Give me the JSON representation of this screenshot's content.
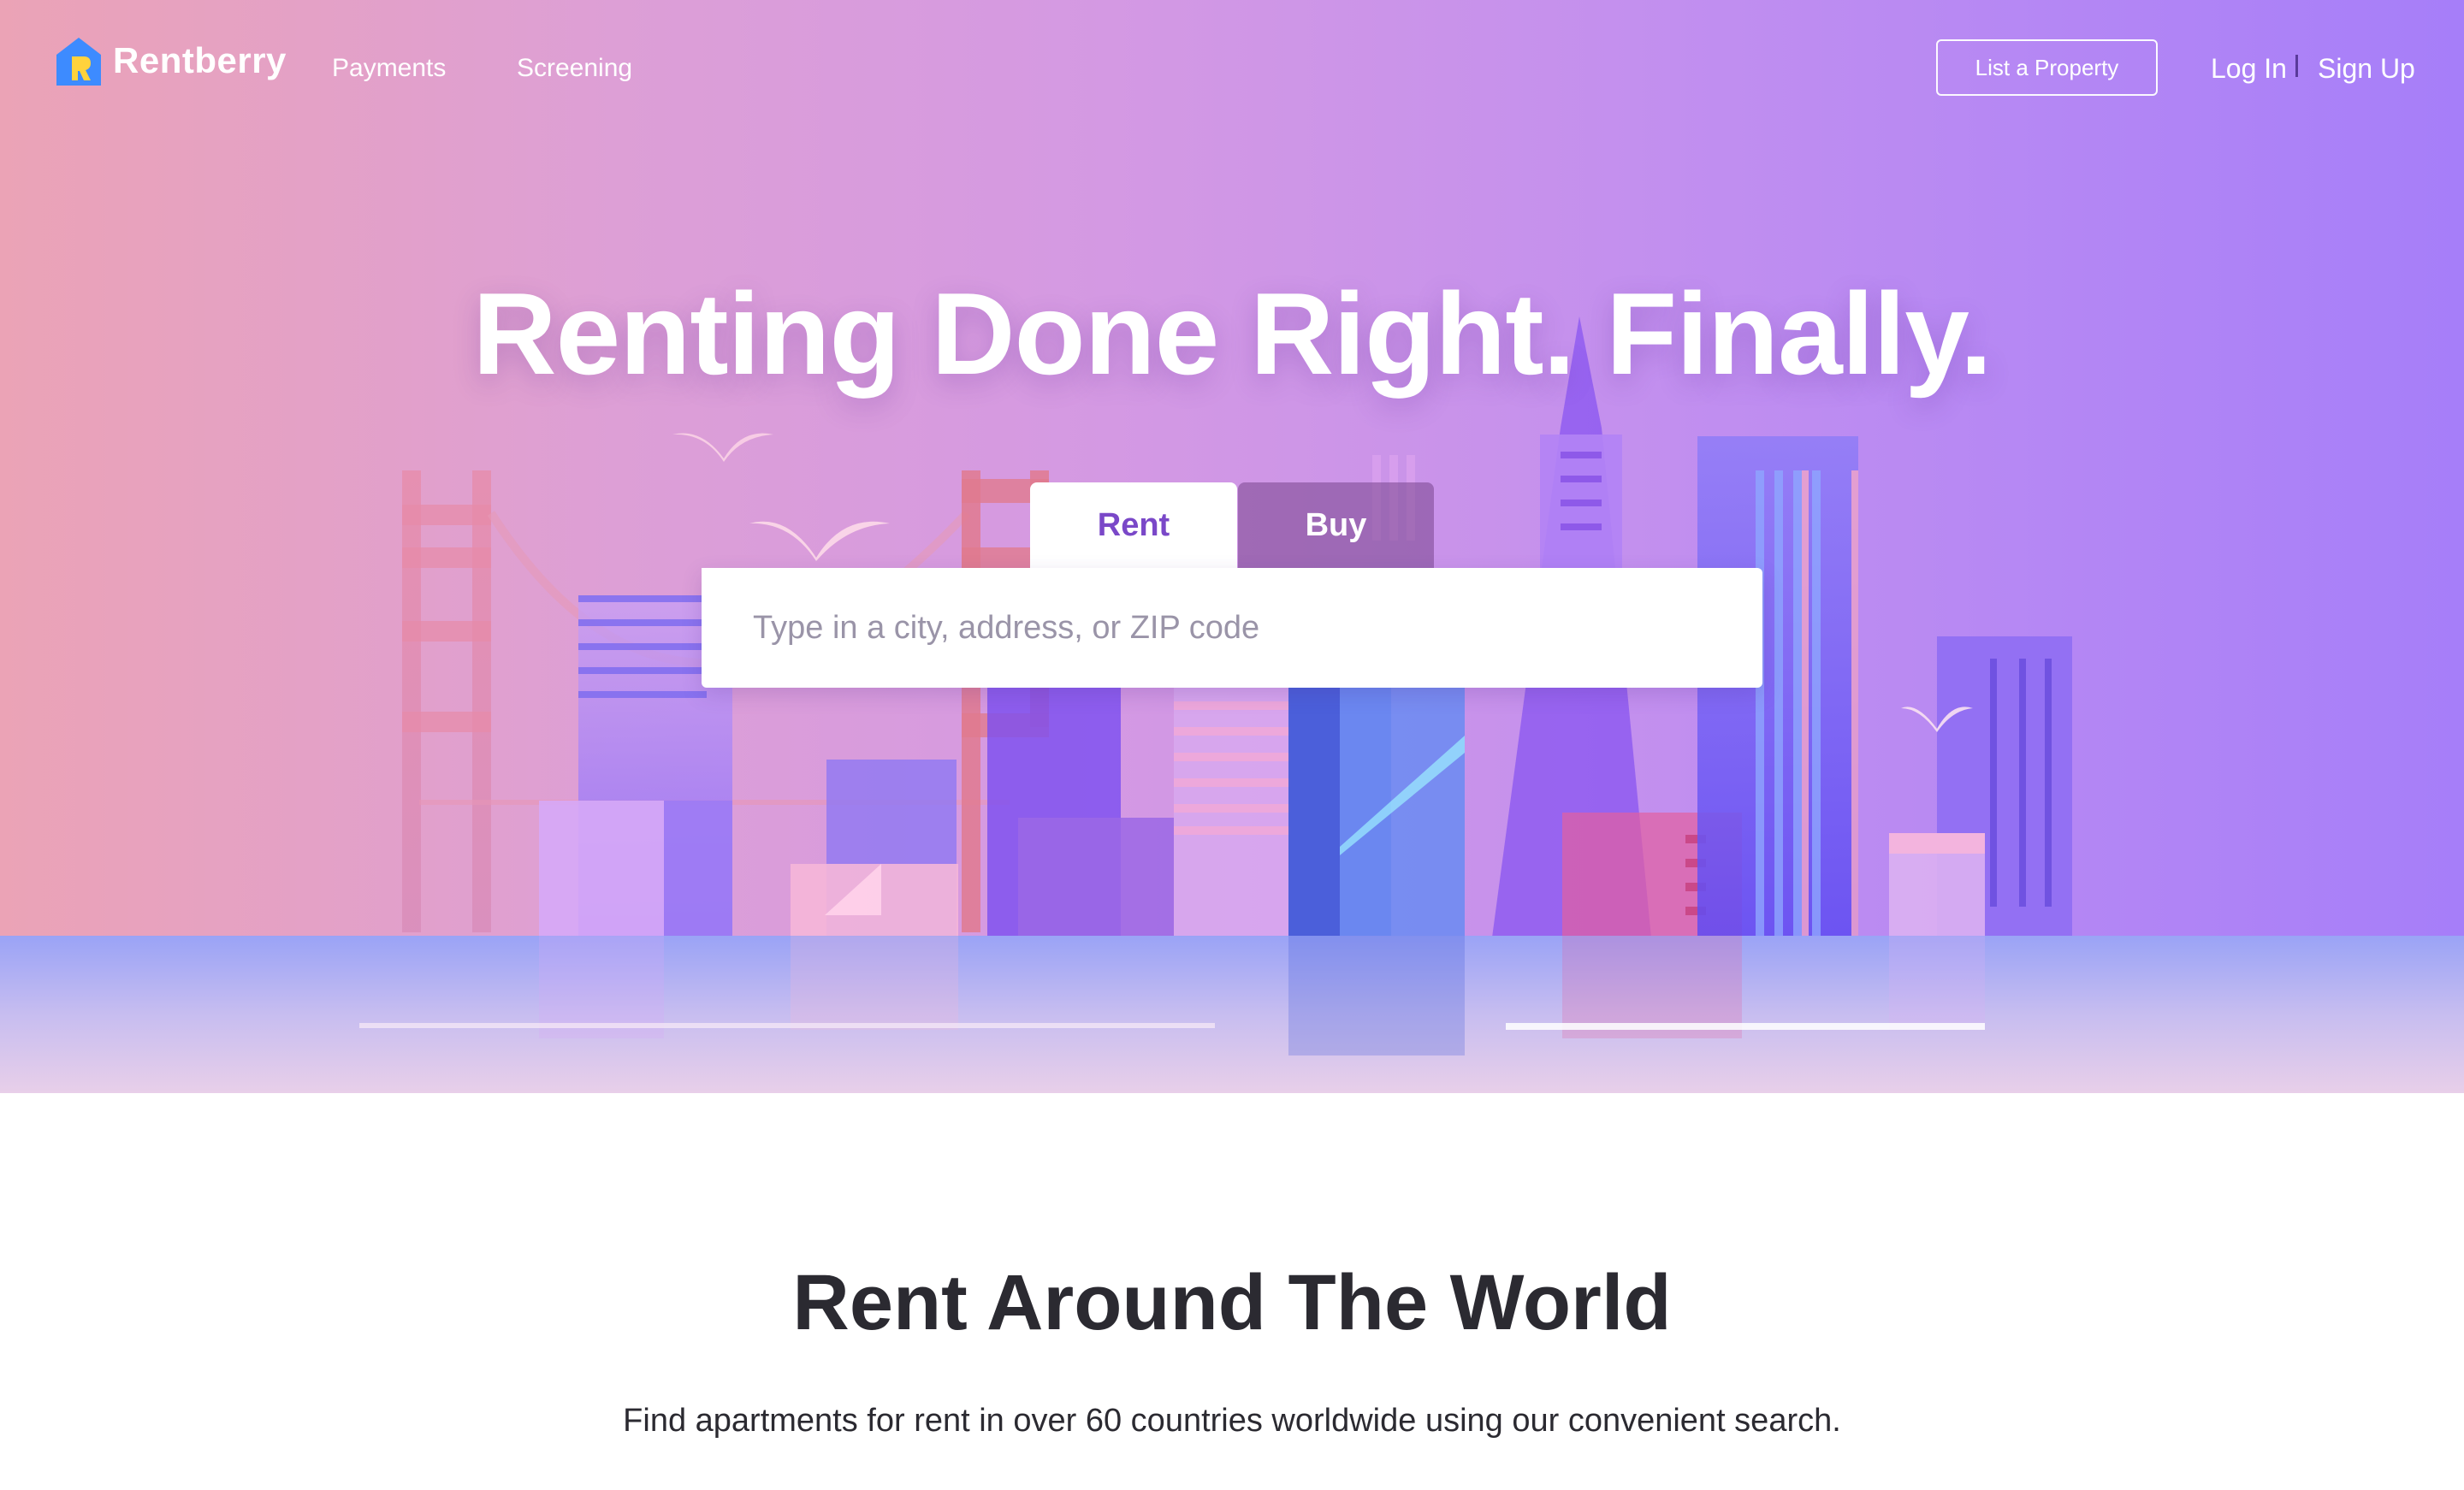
{
  "brand": {
    "name": "Rentberry",
    "logo_colors": {
      "blue": "#3d8bff",
      "yellow": "#ffd23c"
    }
  },
  "nav": {
    "links": [
      {
        "label": "Payments"
      },
      {
        "label": "Screening"
      }
    ],
    "list_property_label": "List a Property",
    "login_label": "Log In",
    "signup_label": "Sign Up"
  },
  "hero": {
    "headline": "Renting Done Right. Finally.",
    "tabs": [
      {
        "label": "Rent",
        "selected": true
      },
      {
        "label": "Buy",
        "selected": false
      }
    ],
    "search": {
      "placeholder": "Type in a city, address, or ZIP code",
      "value": ""
    },
    "gradient_colors": [
      "#eba3b6",
      "#d499e3",
      "#a67ef9"
    ]
  },
  "section": {
    "title": "Rent Around The World",
    "subtitle": "Find apartments for rent in over 60 countries worldwide using our convenient search."
  }
}
